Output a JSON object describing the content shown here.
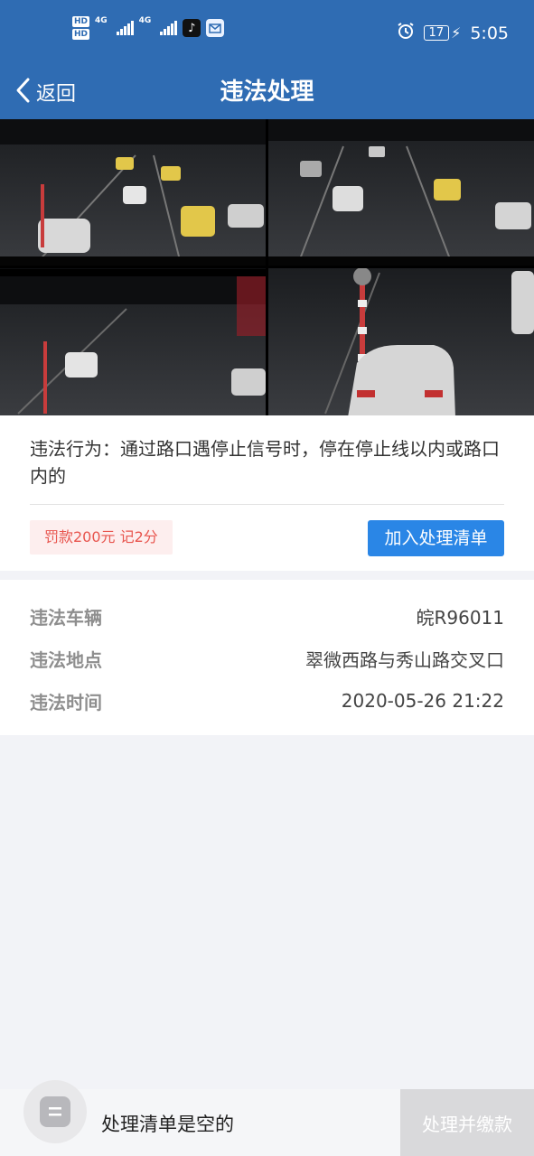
{
  "status_bar": {
    "hd1": "HD",
    "hd2": "HD",
    "net1": "4G",
    "net2": "4G",
    "battery": "17",
    "time": "5:05",
    "icons": [
      "hd-icon",
      "signal-icon",
      "tiktok-icon",
      "huawei-icon",
      "alarm-icon",
      "battery-icon",
      "charging-icon"
    ]
  },
  "nav": {
    "back_label": "返回",
    "title": "违法处理"
  },
  "violation": {
    "description": "违法行为：通过路口遇停止信号时，停在停止线以内或路口内的",
    "fine": "罚款200元 记2分",
    "add_button": "加入处理清单"
  },
  "details": {
    "vehicle_label": "违法车辆",
    "vehicle_value": "皖R96011",
    "location_label": "违法地点",
    "location_value": "翠微西路与秀山路交叉口",
    "time_label": "违法时间",
    "time_value": "2020-05-26 21:22"
  },
  "bottom": {
    "empty_text": "处理清单是空的",
    "pay_button": "处理并缴款"
  },
  "colors": {
    "header": "#2f6cb3",
    "accent": "#2a86e6",
    "fine_text": "#e8554e",
    "fine_bg": "#fdeeee"
  }
}
